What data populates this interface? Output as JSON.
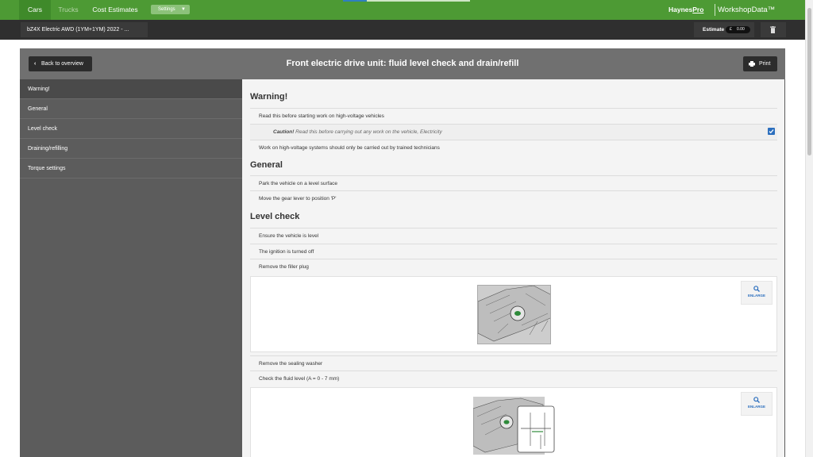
{
  "topnav": {
    "tabs": [
      "Cars",
      "Trucks",
      "Cost Estimates"
    ],
    "settings_label": "Settings",
    "brand": {
      "main": "Haynes",
      "pro": "Pro"
    },
    "product": "WorkshopData™",
    "page_progress": 0.19
  },
  "vehicle_bar": {
    "vehicle": "bZ4X Electric AWD (1YM+1YM) 2022 - ...",
    "estimate_label": "Estimate",
    "currency": "£",
    "amount": "0.00"
  },
  "header": {
    "back_label": "Back to overview",
    "title": "Front electric drive unit: fluid level check and drain/refill",
    "print_label": "Print"
  },
  "sidebar": {
    "items": [
      {
        "label": "Warning!"
      },
      {
        "label": "General"
      },
      {
        "label": "Level check"
      },
      {
        "label": "Draining/refilling"
      },
      {
        "label": "Torque settings"
      }
    ]
  },
  "content": {
    "warning": {
      "title": "Warning!",
      "rows": [
        "Read this before starting work on high-voltage vehicles",
        "Work on high-voltage systems should only be carried out by trained technicians"
      ],
      "caution": {
        "prefix": "Caution!",
        "text": "Read this before carrying out any work on the vehicle, Electricity",
        "checked": true
      }
    },
    "general": {
      "title": "General",
      "rows": [
        "Park the vehicle on a level surface",
        "Move the gear lever to position 'P'"
      ]
    },
    "level_check": {
      "title": "Level check",
      "rows": [
        "Ensure the vehicle is level",
        "The ignition is turned off",
        "Remove the filler plug",
        "Remove the sealing washer",
        "Check the fluid level (A = 0 - 7 mm)"
      ]
    },
    "enlarge_label": "ENLARGE"
  },
  "colors": {
    "brand_green": "#4d9a34",
    "accent_blue": "#2c6fbe",
    "dark_bar": "#2f2f2f"
  }
}
